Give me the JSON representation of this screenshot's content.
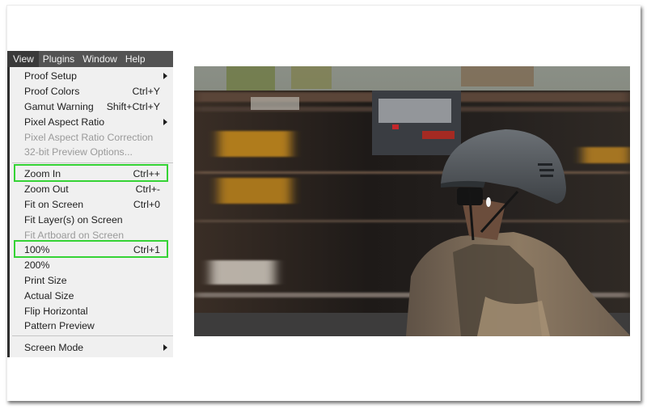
{
  "menubar": {
    "items": [
      {
        "label": "View",
        "active": true
      },
      {
        "label": "Plugins",
        "active": false
      },
      {
        "label": "Window",
        "active": false
      },
      {
        "label": "Help",
        "active": false
      }
    ]
  },
  "view_menu": {
    "items": [
      {
        "label": "Proof Setup",
        "shortcut": "",
        "submenu": true,
        "disabled": false
      },
      {
        "label": "Proof Colors",
        "shortcut": "Ctrl+Y",
        "submenu": false,
        "disabled": false
      },
      {
        "label": "Gamut Warning",
        "shortcut": "Shift+Ctrl+Y",
        "submenu": false,
        "disabled": false
      },
      {
        "label": "Pixel Aspect Ratio",
        "shortcut": "",
        "submenu": true,
        "disabled": false
      },
      {
        "label": "Pixel Aspect Ratio Correction",
        "shortcut": "",
        "submenu": false,
        "disabled": true
      },
      {
        "label": "32-bit Preview Options...",
        "shortcut": "",
        "submenu": false,
        "disabled": true
      },
      {
        "label": "Zoom In",
        "shortcut": "Ctrl++",
        "submenu": false,
        "disabled": false,
        "highlighted": true
      },
      {
        "label": "Zoom Out",
        "shortcut": "Ctrl+-",
        "submenu": false,
        "disabled": false
      },
      {
        "label": "Fit on Screen",
        "shortcut": "Ctrl+0",
        "submenu": false,
        "disabled": false
      },
      {
        "label": "Fit Layer(s) on Screen",
        "shortcut": "",
        "submenu": false,
        "disabled": false
      },
      {
        "label": "Fit Artboard on Screen",
        "shortcut": "",
        "submenu": false,
        "disabled": true
      },
      {
        "label": "100%",
        "shortcut": "Ctrl+1",
        "submenu": false,
        "disabled": false,
        "highlighted": true
      },
      {
        "label": "200%",
        "shortcut": "",
        "submenu": false,
        "disabled": false
      },
      {
        "label": "Print Size",
        "shortcut": "",
        "submenu": false,
        "disabled": false
      },
      {
        "label": "Actual Size",
        "shortcut": "",
        "submenu": false,
        "disabled": false
      },
      {
        "label": "Flip Horizontal",
        "shortcut": "",
        "submenu": false,
        "disabled": false
      },
      {
        "label": "Pattern Preview",
        "shortcut": "",
        "submenu": false,
        "disabled": false
      },
      {
        "label": "Screen Mode",
        "shortcut": "",
        "submenu": true,
        "disabled": false
      }
    ]
  },
  "canvas": {
    "image_description": "Cyclist in gray helmet and tan jacket with motion-blurred train passing behind"
  },
  "colors": {
    "highlight": "#35d335",
    "menubar_bg": "#535353",
    "menu_bg": "#f0f0f0",
    "disabled_text": "#9a9a9a"
  }
}
